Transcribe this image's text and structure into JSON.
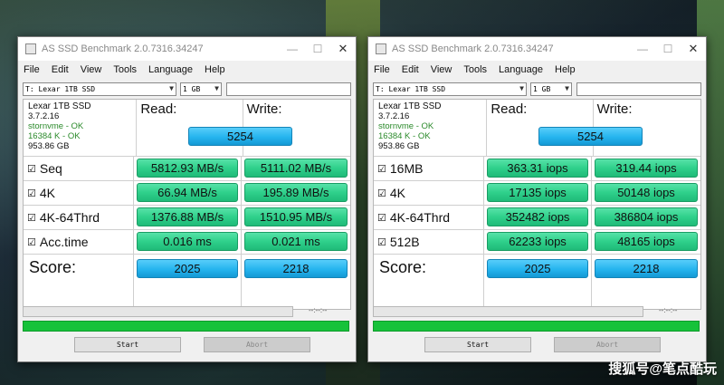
{
  "colors": {
    "result_green": "#2fd08b",
    "score_blue": "#25b4ee",
    "progress_green": "#16c23a"
  },
  "windows": [
    {
      "title": "AS SSD Benchmark 2.0.7316.34247",
      "menu": [
        "File",
        "Edit",
        "View",
        "Tools",
        "Language",
        "Help"
      ],
      "drive_select": "T: Lexar 1TB SSD",
      "size_select": "1 GB",
      "info": {
        "name": "Lexar 1TB SSD",
        "version": "3.7.2.16",
        "driver": "stornvme - OK",
        "align": "16384 K - OK",
        "capacity": "953.86 GB"
      },
      "read_label": "Read:",
      "write_label": "Write:",
      "tests": [
        {
          "label": "Seq",
          "read": "5812.93 MB/s",
          "write": "5111.02 MB/s"
        },
        {
          "label": "4K",
          "read": "66.94 MB/s",
          "write": "195.89 MB/s"
        },
        {
          "label": "4K-64Thrd",
          "read": "1376.88 MB/s",
          "write": "1510.95 MB/s"
        },
        {
          "label": "Acc.time",
          "read": "0.016 ms",
          "write": "0.021 ms"
        }
      ],
      "score_label": "Score:",
      "score": {
        "read": "2025",
        "write": "2218",
        "total": "5254"
      },
      "timer": "--:--:--",
      "progress": 1.0,
      "start_label": "Start",
      "abort_label": "Abort"
    },
    {
      "title": "AS SSD Benchmark 2.0.7316.34247",
      "menu": [
        "File",
        "Edit",
        "View",
        "Tools",
        "Language",
        "Help"
      ],
      "drive_select": "T: Lexar 1TB SSD",
      "size_select": "1 GB",
      "info": {
        "name": "Lexar 1TB SSD",
        "version": "3.7.2.16",
        "driver": "stornvme - OK",
        "align": "16384 K - OK",
        "capacity": "953.86 GB"
      },
      "read_label": "Read:",
      "write_label": "Write:",
      "tests": [
        {
          "label": "16MB",
          "read": "363.31 iops",
          "write": "319.44 iops"
        },
        {
          "label": "4K",
          "read": "17135 iops",
          "write": "50148 iops"
        },
        {
          "label": "4K-64Thrd",
          "read": "352482 iops",
          "write": "386804 iops"
        },
        {
          "label": "512B",
          "read": "62233 iops",
          "write": "48165 iops"
        }
      ],
      "score_label": "Score:",
      "score": {
        "read": "2025",
        "write": "2218",
        "total": "5254"
      },
      "timer": "--:--:--",
      "progress": 1.0,
      "start_label": "Start",
      "abort_label": "Abort"
    }
  ],
  "watermark": "搜狐号@笔点酷玩"
}
